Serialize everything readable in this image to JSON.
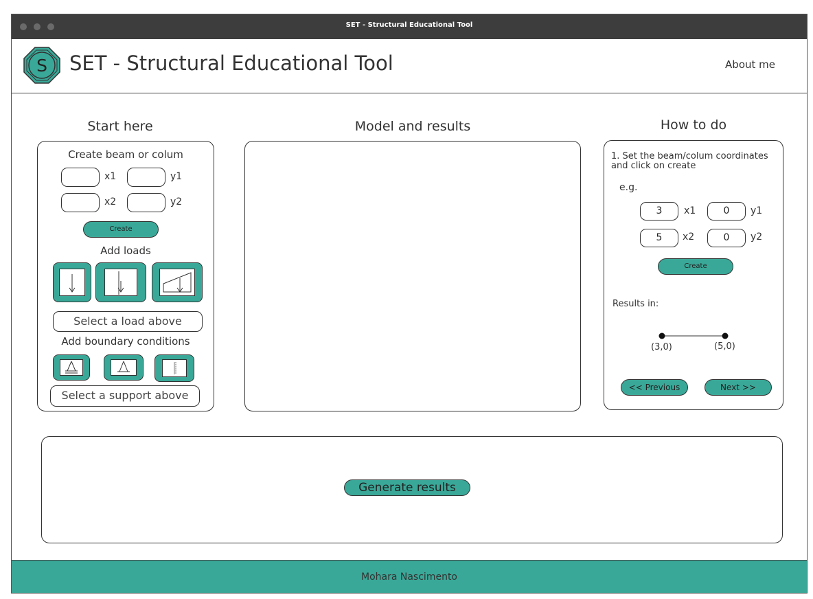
{
  "window": {
    "title": "SET - Structural Educational Tool"
  },
  "header": {
    "logo_letter": "S",
    "title": "SET - Structural Educational Tool",
    "about_label": "About me"
  },
  "colors": {
    "accent": "#3aa898",
    "titlebar": "#3d3d3d"
  },
  "start": {
    "heading": "Start here",
    "create_heading": "Create beam or colum",
    "labels": {
      "x1": "x1",
      "y1": "y1",
      "x2": "x2",
      "y2": "y2"
    },
    "create_button": "Create",
    "loads_heading": "Add loads",
    "load_icons": [
      "point-load-icon",
      "distributed-load-icon",
      "trapezoidal-load-icon"
    ],
    "load_select": "Select a load above",
    "boundary_heading": "Add boundary conditions",
    "support_icons": [
      "fixed-pin-support-icon",
      "pin-support-icon",
      "clamped-support-icon"
    ],
    "support_select": "Select a support above"
  },
  "model": {
    "heading": "Model and results"
  },
  "howto": {
    "heading": "How to do",
    "step_text": "1. Set the beam/colum coordinates and click on create",
    "example_label": "e.g.",
    "example": {
      "x1": "3",
      "y1": "0",
      "x2": "5",
      "y2": "0"
    },
    "labels": {
      "x1": "x1",
      "y1": "y1",
      "x2": "x2",
      "y2": "y2"
    },
    "create_button": "Create",
    "results_label": "Results in:",
    "point_a": "(3,0)",
    "point_b": "(5,0)",
    "prev_button": "<< Previous",
    "next_button": "Next >>"
  },
  "results": {
    "generate_button": "Generate results"
  },
  "footer": {
    "author": "Mohara Nascimento"
  }
}
